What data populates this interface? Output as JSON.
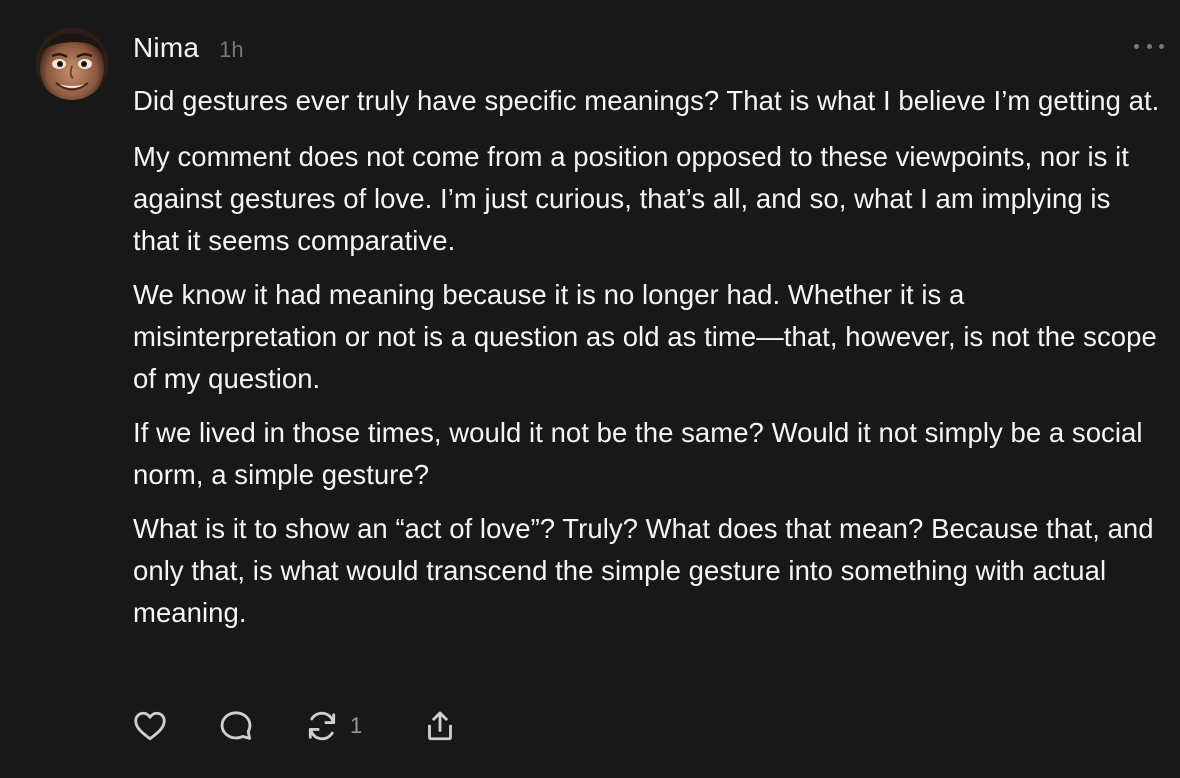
{
  "post": {
    "username": "Nima",
    "timestamp": "1h",
    "paragraphs": [
      "Did gestures ever truly have specific meanings? That is what I believe I’m getting at.",
      "My comment does not come from a position opposed to these viewpoints, nor is it against gestures of love. I’m just curious, that’s all, and so, what I am implying is that it seems comparative.",
      "We know it had meaning because it is no longer had. Whether it is a misinterpretation or not is a question as old as time—that, however, is not the scope of my question.",
      "If we lived in those times, would it not be the same? Would it not simply be a social norm, a simple gesture?",
      "What is it to show an “act of love”? Truly? What does that mean? Because that, and only that, is what would transcend the simple gesture into something with actual meaning."
    ],
    "repost_count": "1"
  },
  "icons": {
    "like": "heart-icon",
    "reply": "comment-bubble-icon",
    "repost": "repost-icon",
    "share": "share-icon",
    "more": "more-options-icon"
  },
  "colors": {
    "background": "#181818",
    "text": "#f3f5f7",
    "muted": "#777777"
  }
}
